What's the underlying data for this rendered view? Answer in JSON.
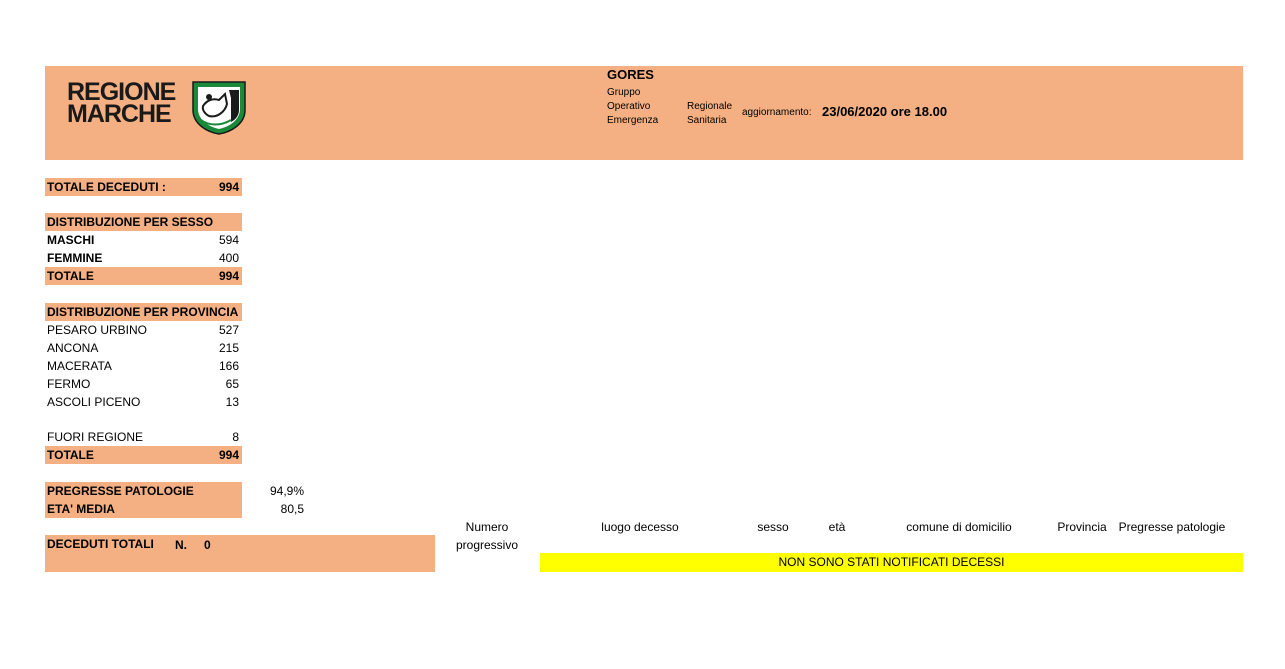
{
  "header": {
    "logo_line1": "REGIONE",
    "logo_line2": "MARCHE",
    "gores_title": "GORES",
    "gores_words": [
      "Gruppo",
      "Operativo",
      "Regionale",
      "Emergenza",
      "Sanitaria"
    ],
    "update_label": "aggiornamento:",
    "update_value": "23/06/2020 ore 18.00"
  },
  "totale_deceduti": {
    "label": "TOTALE DECEDUTI :",
    "value": "994"
  },
  "sesso": {
    "title": "DISTRIBUZIONE PER SESSO",
    "rows": [
      {
        "label": "MASCHI",
        "value": "594"
      },
      {
        "label": "FEMMINE",
        "value": "400"
      }
    ],
    "total": {
      "label": "TOTALE",
      "value": "994"
    }
  },
  "provincia": {
    "title": "DISTRIBUZIONE PER PROVINCIA",
    "rows": [
      {
        "label": "PESARO URBINO",
        "value": "527"
      },
      {
        "label": "ANCONA",
        "value": "215"
      },
      {
        "label": "MACERATA",
        "value": "166"
      },
      {
        "label": "FERMO",
        "value": "65"
      },
      {
        "label": "ASCOLI PICENO",
        "value": "13"
      }
    ],
    "fuori": {
      "label": "FUORI REGIONE",
      "value": "8"
    },
    "total": {
      "label": "TOTALE",
      "value": "994"
    }
  },
  "stats": {
    "patologie": {
      "label": "PREGRESSE PATOLOGIE",
      "value": "94,9%"
    },
    "eta": {
      "label": "ETA' MEDIA",
      "value": "80,5"
    }
  },
  "deceduti_totali": {
    "label": "DECEDUTI TOTALI",
    "n_label": "N.",
    "value": "0"
  },
  "table": {
    "headers": {
      "numero_line1": "Numero",
      "numero_line2": "progressivo",
      "luogo": "luogo decesso",
      "sesso": "sesso",
      "eta": "età",
      "comune": "comune di domicilio",
      "provincia": "Provincia",
      "patologie": "Pregresse patologie"
    },
    "notice": "NON SONO STATI NOTIFICATI DECESSI"
  },
  "colors": {
    "header_bg": "#f4b083",
    "notice_bg": "#ffff00"
  }
}
